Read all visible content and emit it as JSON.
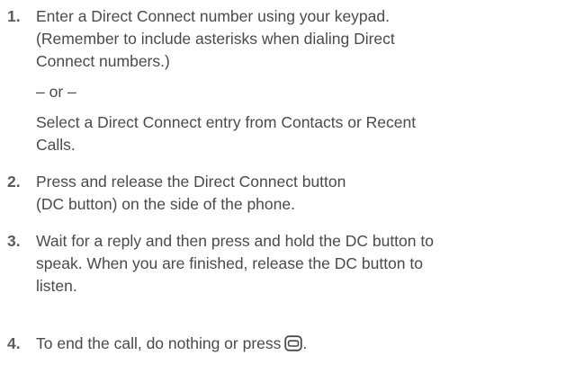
{
  "steps": [
    {
      "number": "1.",
      "lines": [
        "Enter a Direct Connect number using your keypad.",
        "(Remember to include asterisks when dialing Direct",
        "Connect numbers.)"
      ],
      "or_text": "– or –",
      "alt_lines": [
        "Select a Direct Connect entry from Contacts or Recent",
        "Calls."
      ]
    },
    {
      "number": "2.",
      "lines": [
        "Press and release the Direct Connect button",
        "(DC button) on the side of the phone."
      ]
    },
    {
      "number": "3.",
      "lines": [
        "Wait for a reply and then press and hold the DC button to",
        "speak. When you are finished, release the DC button to",
        "listen."
      ]
    },
    {
      "number": "4.",
      "text": "To end the call, do nothing or press",
      "icon": "end-key-icon",
      "text_end": "."
    }
  ]
}
